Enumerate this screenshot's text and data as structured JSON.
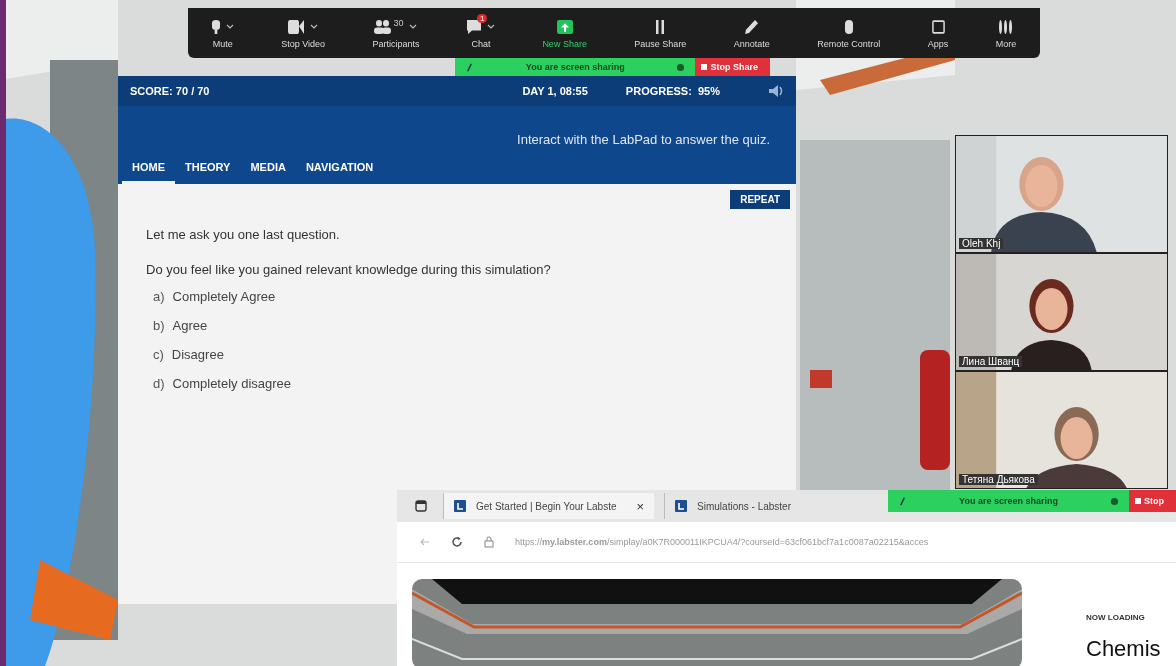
{
  "toolbar": {
    "items": [
      {
        "label": "Mute",
        "caret": true
      },
      {
        "label": "Stop Video",
        "caret": true
      },
      {
        "label": "Participants",
        "caret": true,
        "count": "30"
      },
      {
        "label": "Chat",
        "caret": true,
        "badge": "1"
      },
      {
        "label": "New Share",
        "caret": false,
        "highlight": true
      },
      {
        "label": "Pause Share",
        "caret": false
      },
      {
        "label": "Annotate",
        "caret": false
      },
      {
        "label": "Remote Control",
        "caret": false
      },
      {
        "label": "Apps",
        "caret": false
      },
      {
        "label": "More",
        "caret": false
      }
    ]
  },
  "share_banner": {
    "text": "You are screen sharing",
    "stop": "Stop Share"
  },
  "labpad": {
    "score": "SCORE: 70 / 70",
    "day": "DAY 1, 08:55",
    "progress": "PROGRESS:  95%",
    "hint": "Interact with the LabPad to answer the quiz.",
    "tabs": [
      {
        "label": "HOME",
        "selected": true
      },
      {
        "label": "THEORY",
        "selected": false
      },
      {
        "label": "MEDIA",
        "selected": false
      },
      {
        "label": "NAVIGATION",
        "selected": false
      }
    ],
    "repeat": "REPEAT",
    "intro": "Let me ask you one last question.",
    "question": "Do you feel like you gained relevant knowledge during this simulation?",
    "options": [
      {
        "letter": "a)",
        "text": "Completely Agree"
      },
      {
        "letter": "b)",
        "text": "Agree"
      },
      {
        "letter": "c)",
        "text": "Disagree"
      },
      {
        "letter": "d)",
        "text": "Completely disagree"
      }
    ]
  },
  "participants": [
    {
      "name": "Oleh Khj"
    },
    {
      "name": "Лина Шванц"
    },
    {
      "name": "Тетяна Дьякова"
    }
  ],
  "browser": {
    "tabs": [
      {
        "title": "Get Started | Begin Your Labste",
        "close": "×",
        "selected": true
      },
      {
        "title": "Simulations - Labster",
        "selected": false
      }
    ],
    "url": "https://**my.labster.com**/simplay/a0K7R000011IKPCUA4/?courseId=63cf061bcf7a1c0087a02215&acces",
    "share_banner": {
      "text": "You are screen sharing",
      "stop": "Stop"
    },
    "loading_label": "NOW LOADING",
    "loading_title": "Chemis"
  }
}
